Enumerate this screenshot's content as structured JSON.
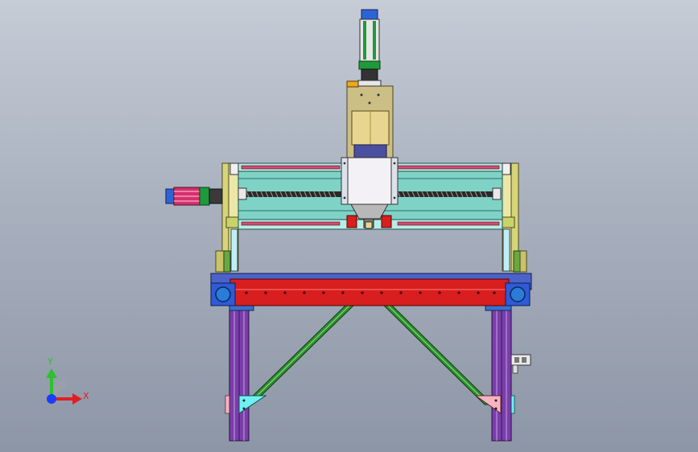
{
  "viewport": {
    "background_top": "#c6ccd6",
    "background_bottom": "#8d96a6"
  },
  "triad": {
    "x_label": "X",
    "y_label": "Y",
    "x_color": "#e02020",
    "y_color": "#2fbf2f",
    "z_color": "#1a3cff"
  },
  "model": {
    "description_icons": [
      "spindle-motor-icon",
      "x-axis-motor-icon"
    ],
    "colors": {
      "beam": "#7fd3c6",
      "rail": "#d64b6e",
      "side_plate": "#d8d47a",
      "base_beam": "#d81e1e",
      "legs": "#7a3ea8",
      "braces": "#2f8f2f",
      "spindle_body": "#f4f1f6",
      "spindle_housing": "#cbbf86",
      "motor_green": "#1e9a3a",
      "motor_blue": "#2e63d6",
      "gusset_cyan": "#6ff1f1",
      "gusset_pink": "#f6b4c0"
    }
  }
}
